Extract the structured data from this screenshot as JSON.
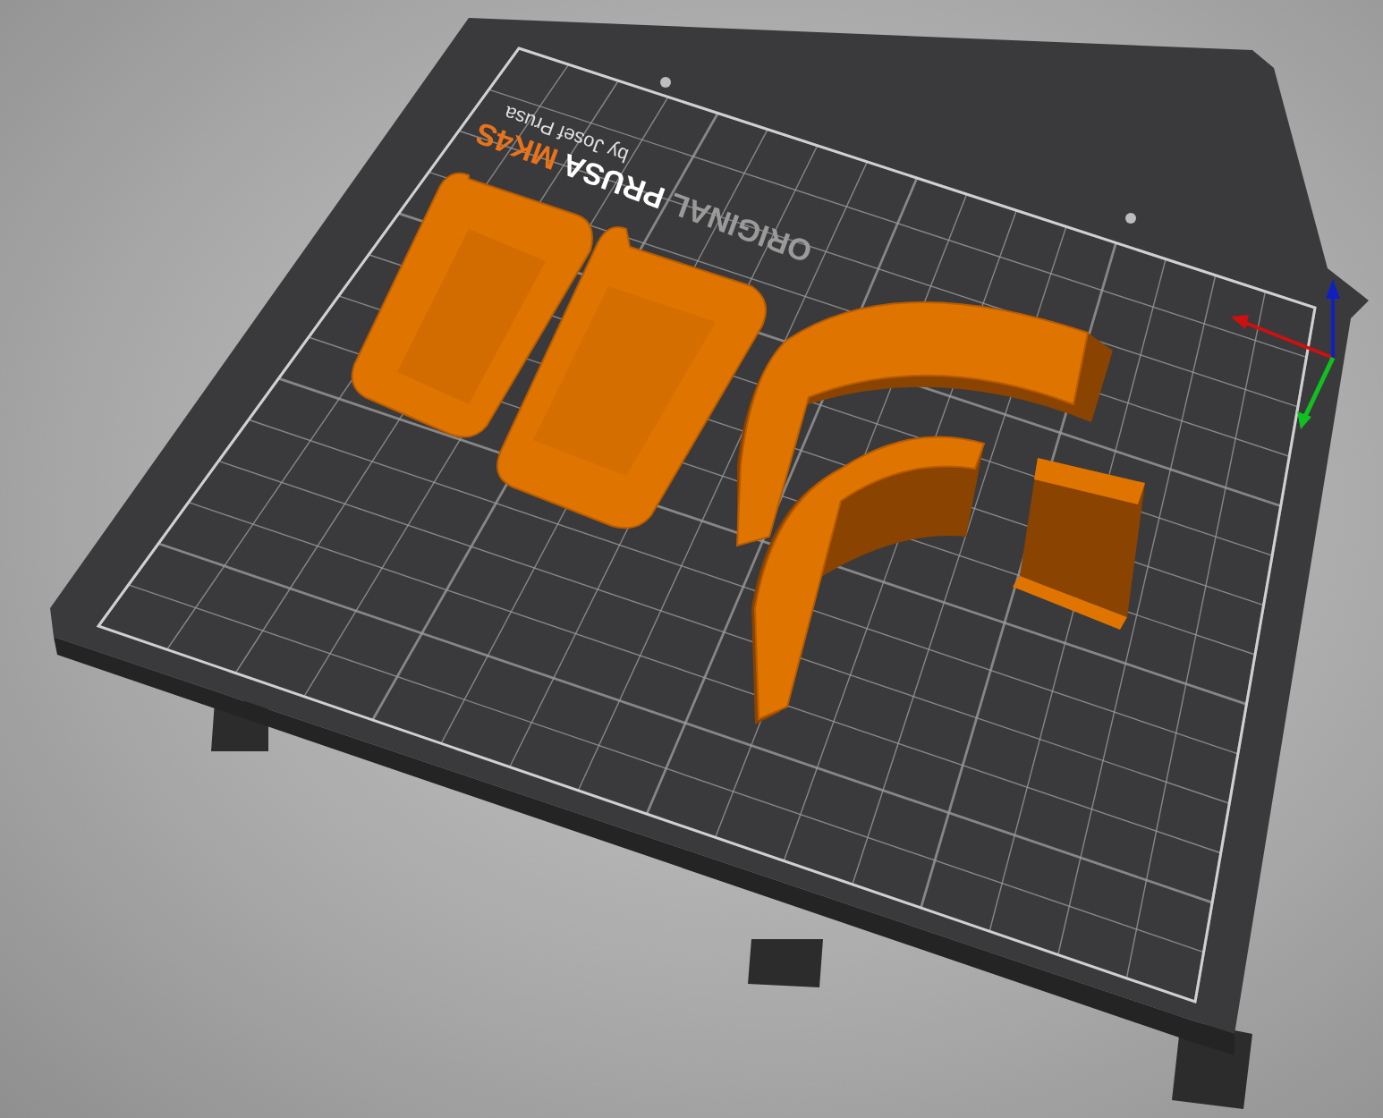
{
  "bed": {
    "logo": [
      {
        "text": "ORIGINAL",
        "kind": "muted"
      },
      {
        "text": "PRUSA",
        "kind": "bold"
      },
      {
        "text": "MK4S",
        "kind": "accent"
      }
    ],
    "byline": "by Josef Prusa"
  }
}
